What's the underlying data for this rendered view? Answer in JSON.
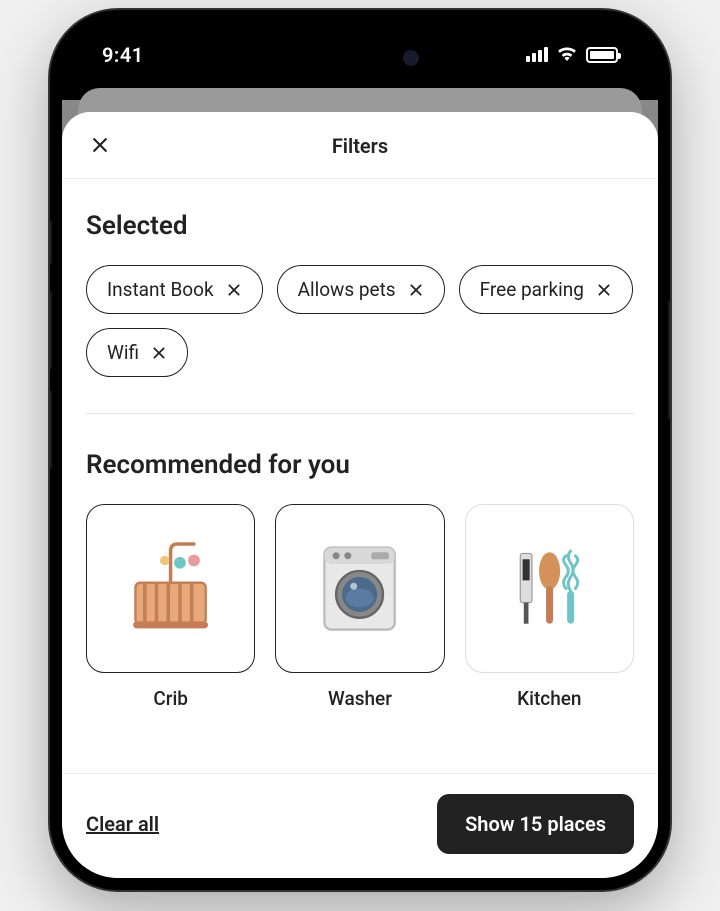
{
  "statusBar": {
    "time": "9:41"
  },
  "header": {
    "title": "Filters"
  },
  "selected": {
    "title": "Selected",
    "chips": [
      {
        "label": "Instant Book"
      },
      {
        "label": "Allows pets"
      },
      {
        "label": "Free parking"
      },
      {
        "label": "Wifi"
      }
    ]
  },
  "recommended": {
    "title": "Recommended for you",
    "items": [
      {
        "label": "Crib",
        "selected": true,
        "icon": "crib"
      },
      {
        "label": "Washer",
        "selected": true,
        "icon": "washer"
      },
      {
        "label": "Kitchen",
        "selected": false,
        "icon": "kitchen"
      }
    ]
  },
  "footer": {
    "clearLabel": "Clear all",
    "showLabel": "Show 15 places"
  }
}
